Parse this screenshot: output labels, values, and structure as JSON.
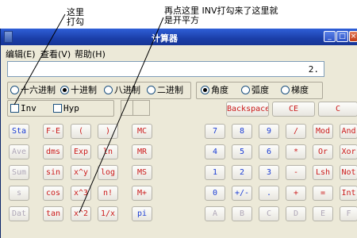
{
  "annotations": {
    "note1_line1": "这里",
    "note1_line2": "打勾",
    "note2_line1": "再点这里 INV打勾来了这里就",
    "note2_line2": "是开平方"
  },
  "window": {
    "title": "计算器",
    "minimize": "_",
    "maximize": "□",
    "close": "×"
  },
  "menu": [
    "编辑(E)",
    "查看(V)",
    "帮助(H)"
  ],
  "display": {
    "value": "2."
  },
  "radix": [
    {
      "label": "十六进制",
      "selected": false
    },
    {
      "label": "十进制",
      "selected": true
    },
    {
      "label": "八进制",
      "selected": false
    },
    {
      "label": "二进制",
      "selected": false
    }
  ],
  "angle": [
    {
      "label": "角度",
      "selected": true
    },
    {
      "label": "弧度",
      "selected": false
    },
    {
      "label": "梯度",
      "selected": false
    }
  ],
  "checks": {
    "inv": "Inv",
    "hyp": "Hyp"
  },
  "edit_buttons": {
    "backspace": "Backspace",
    "ce": "CE",
    "c": "C"
  },
  "sci_col1": [
    "Sta",
    "Ave",
    "Sum",
    "s",
    "Dat"
  ],
  "sci_col2": [
    "F-E",
    "dms",
    "sin",
    "cos",
    "tan"
  ],
  "sci_col3": [
    "(",
    "Exp",
    "x^y",
    "x^3",
    "x^2"
  ],
  "sci_col4": [
    ")",
    "ln",
    "log",
    "n!",
    "1/x"
  ],
  "mem": [
    "MC",
    "MR",
    "MS",
    "M+",
    "pi"
  ],
  "digits": {
    "row1": [
      "7",
      "8",
      "9",
      "/",
      "Mod",
      "And"
    ],
    "row2": [
      "4",
      "5",
      "6",
      "*",
      "Or",
      "Xor"
    ],
    "row3": [
      "1",
      "2",
      "3",
      "-",
      "Lsh",
      "Not"
    ],
    "row4": [
      "0",
      "+/-",
      ".",
      "+",
      "=",
      "Int"
    ],
    "row5": [
      "A",
      "B",
      "C",
      "D",
      "E",
      "F"
    ]
  },
  "colors": {
    "blue": "#1a3cd4",
    "red": "#cc1b1b",
    "dim": "#b0a8b8",
    "titlebar": "#1b3ea8"
  }
}
